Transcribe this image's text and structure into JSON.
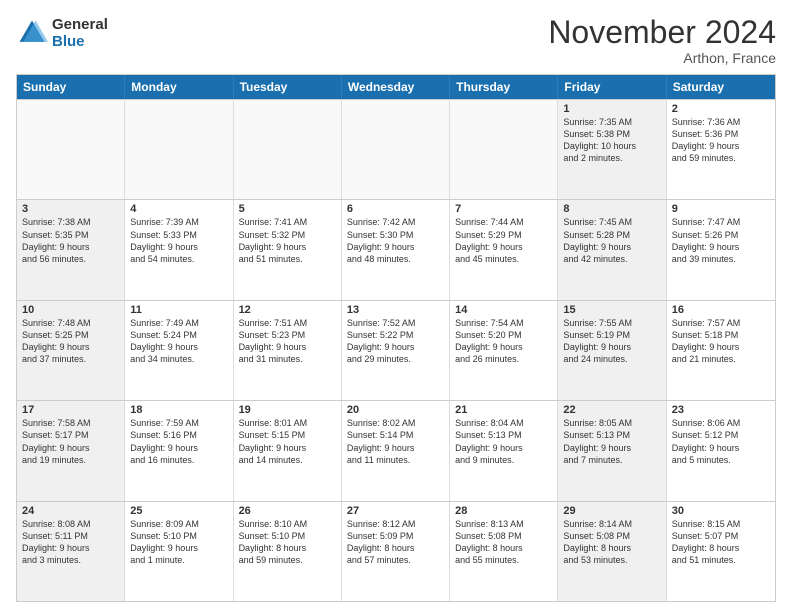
{
  "logo": {
    "line1": "General",
    "line2": "Blue"
  },
  "title": "November 2024",
  "location": "Arthon, France",
  "header_days": [
    "Sunday",
    "Monday",
    "Tuesday",
    "Wednesday",
    "Thursday",
    "Friday",
    "Saturday"
  ],
  "rows": [
    [
      {
        "day": "",
        "info": "",
        "empty": true
      },
      {
        "day": "",
        "info": "",
        "empty": true
      },
      {
        "day": "",
        "info": "",
        "empty": true
      },
      {
        "day": "",
        "info": "",
        "empty": true
      },
      {
        "day": "",
        "info": "",
        "empty": true
      },
      {
        "day": "1",
        "info": "Sunrise: 7:35 AM\nSunset: 5:38 PM\nDaylight: 10 hours\nand 2 minutes.",
        "shaded": true
      },
      {
        "day": "2",
        "info": "Sunrise: 7:36 AM\nSunset: 5:36 PM\nDaylight: 9 hours\nand 59 minutes."
      }
    ],
    [
      {
        "day": "3",
        "info": "Sunrise: 7:38 AM\nSunset: 5:35 PM\nDaylight: 9 hours\nand 56 minutes.",
        "shaded": true
      },
      {
        "day": "4",
        "info": "Sunrise: 7:39 AM\nSunset: 5:33 PM\nDaylight: 9 hours\nand 54 minutes."
      },
      {
        "day": "5",
        "info": "Sunrise: 7:41 AM\nSunset: 5:32 PM\nDaylight: 9 hours\nand 51 minutes."
      },
      {
        "day": "6",
        "info": "Sunrise: 7:42 AM\nSunset: 5:30 PM\nDaylight: 9 hours\nand 48 minutes."
      },
      {
        "day": "7",
        "info": "Sunrise: 7:44 AM\nSunset: 5:29 PM\nDaylight: 9 hours\nand 45 minutes."
      },
      {
        "day": "8",
        "info": "Sunrise: 7:45 AM\nSunset: 5:28 PM\nDaylight: 9 hours\nand 42 minutes.",
        "shaded": true
      },
      {
        "day": "9",
        "info": "Sunrise: 7:47 AM\nSunset: 5:26 PM\nDaylight: 9 hours\nand 39 minutes."
      }
    ],
    [
      {
        "day": "10",
        "info": "Sunrise: 7:48 AM\nSunset: 5:25 PM\nDaylight: 9 hours\nand 37 minutes.",
        "shaded": true
      },
      {
        "day": "11",
        "info": "Sunrise: 7:49 AM\nSunset: 5:24 PM\nDaylight: 9 hours\nand 34 minutes."
      },
      {
        "day": "12",
        "info": "Sunrise: 7:51 AM\nSunset: 5:23 PM\nDaylight: 9 hours\nand 31 minutes."
      },
      {
        "day": "13",
        "info": "Sunrise: 7:52 AM\nSunset: 5:22 PM\nDaylight: 9 hours\nand 29 minutes."
      },
      {
        "day": "14",
        "info": "Sunrise: 7:54 AM\nSunset: 5:20 PM\nDaylight: 9 hours\nand 26 minutes."
      },
      {
        "day": "15",
        "info": "Sunrise: 7:55 AM\nSunset: 5:19 PM\nDaylight: 9 hours\nand 24 minutes.",
        "shaded": true
      },
      {
        "day": "16",
        "info": "Sunrise: 7:57 AM\nSunset: 5:18 PM\nDaylight: 9 hours\nand 21 minutes."
      }
    ],
    [
      {
        "day": "17",
        "info": "Sunrise: 7:58 AM\nSunset: 5:17 PM\nDaylight: 9 hours\nand 19 minutes.",
        "shaded": true
      },
      {
        "day": "18",
        "info": "Sunrise: 7:59 AM\nSunset: 5:16 PM\nDaylight: 9 hours\nand 16 minutes."
      },
      {
        "day": "19",
        "info": "Sunrise: 8:01 AM\nSunset: 5:15 PM\nDaylight: 9 hours\nand 14 minutes."
      },
      {
        "day": "20",
        "info": "Sunrise: 8:02 AM\nSunset: 5:14 PM\nDaylight: 9 hours\nand 11 minutes."
      },
      {
        "day": "21",
        "info": "Sunrise: 8:04 AM\nSunset: 5:13 PM\nDaylight: 9 hours\nand 9 minutes."
      },
      {
        "day": "22",
        "info": "Sunrise: 8:05 AM\nSunset: 5:13 PM\nDaylight: 9 hours\nand 7 minutes.",
        "shaded": true
      },
      {
        "day": "23",
        "info": "Sunrise: 8:06 AM\nSunset: 5:12 PM\nDaylight: 9 hours\nand 5 minutes."
      }
    ],
    [
      {
        "day": "24",
        "info": "Sunrise: 8:08 AM\nSunset: 5:11 PM\nDaylight: 9 hours\nand 3 minutes.",
        "shaded": true
      },
      {
        "day": "25",
        "info": "Sunrise: 8:09 AM\nSunset: 5:10 PM\nDaylight: 9 hours\nand 1 minute."
      },
      {
        "day": "26",
        "info": "Sunrise: 8:10 AM\nSunset: 5:10 PM\nDaylight: 8 hours\nand 59 minutes."
      },
      {
        "day": "27",
        "info": "Sunrise: 8:12 AM\nSunset: 5:09 PM\nDaylight: 8 hours\nand 57 minutes."
      },
      {
        "day": "28",
        "info": "Sunrise: 8:13 AM\nSunset: 5:08 PM\nDaylight: 8 hours\nand 55 minutes."
      },
      {
        "day": "29",
        "info": "Sunrise: 8:14 AM\nSunset: 5:08 PM\nDaylight: 8 hours\nand 53 minutes.",
        "shaded": true
      },
      {
        "day": "30",
        "info": "Sunrise: 8:15 AM\nSunset: 5:07 PM\nDaylight: 8 hours\nand 51 minutes."
      }
    ]
  ]
}
